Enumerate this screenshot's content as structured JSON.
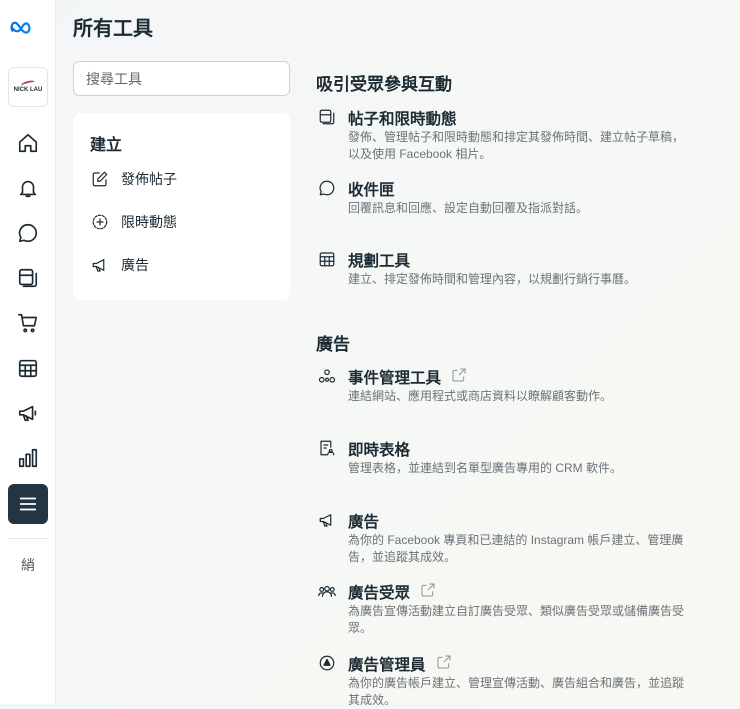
{
  "header": {
    "title": "所有工具"
  },
  "search": {
    "placeholder": "搜尋工具"
  },
  "profile": {
    "logo_text": "NICK LAU"
  },
  "sidebar": {
    "items": [
      "home",
      "notifications",
      "inbox",
      "pages",
      "shop",
      "planner",
      "ads",
      "insights",
      "all-tools"
    ],
    "extra_glyph": "綃"
  },
  "create": {
    "heading": "建立",
    "items": [
      {
        "label": "發佈帖子"
      },
      {
        "label": "限時動態"
      },
      {
        "label": "廣告"
      }
    ]
  },
  "sections": [
    {
      "title": "吸引受眾參與互動",
      "items": [
        {
          "name": "帖子和限時動態",
          "desc": "發佈、管理帖子和限時動態和排定其發佈時間、建立帖子草稿，以及使用 Facebook 相片。"
        },
        {
          "name": "收件匣",
          "desc": "回覆訊息和回應、設定自動回覆及指派對話。"
        },
        {
          "name": "規劃工具",
          "desc": "建立、排定發佈時間和管理內容，以規劃行銷行事曆。"
        }
      ]
    },
    {
      "title": "廣告",
      "items": [
        {
          "name": "事件管理工具",
          "desc": "連結網站、應用程式或商店資料以瞭解顧客動作。"
        },
        {
          "name": "即時表格",
          "desc": "管理表格，並連結到名單型廣告專用的 CRM 軟件。"
        },
        {
          "name": "廣告",
          "desc": "為你的 Facebook 專頁和已連結的 Instagram 帳戶建立、管理廣告，並追蹤其成效。"
        },
        {
          "name": "廣告受眾",
          "desc": "為廣告宣傳活動建立自訂廣告受眾、類似廣告受眾或儲備廣告受眾。"
        },
        {
          "name": "廣告管理員",
          "desc": "為你的廣告帳戶建立、管理宣傳活動、廣告組合和廣告，並追蹤其成效。"
        }
      ]
    }
  ]
}
